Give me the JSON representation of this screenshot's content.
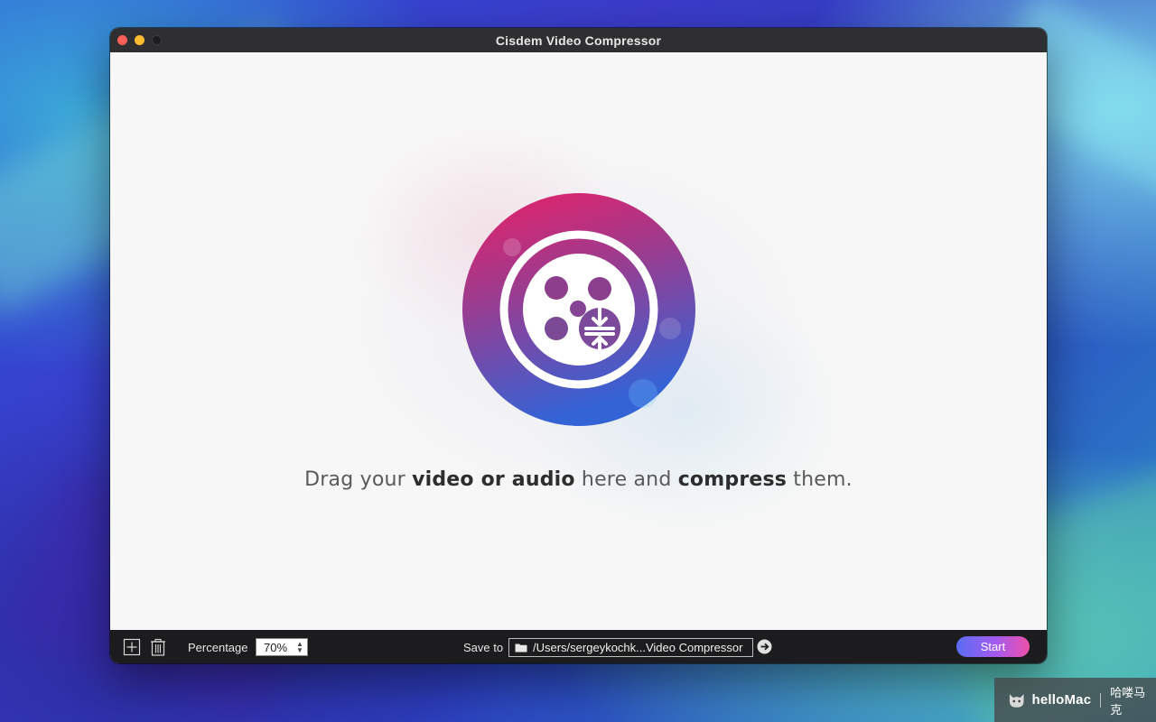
{
  "window": {
    "title": "Cisdem Video Compressor"
  },
  "content": {
    "drop_text_1": "Drag your ",
    "drop_text_bold_1": "video or audio",
    "drop_text_2": " here and ",
    "drop_text_bold_2": "compress",
    "drop_text_3": " them.",
    "logo_icon": "film-reel-compress-icon"
  },
  "toolbar": {
    "add_icon": "plus-square-icon",
    "trash_icon": "trash-icon",
    "percentage_label": "Percentage",
    "percentage_value": "70%",
    "save_to_label": "Save to",
    "save_path": "/Users/sergeykochk...Video Compressor",
    "go_icon": "arrow-right-circle-icon",
    "start_label": "Start"
  },
  "watermark": {
    "brand": "helloMac",
    "brand_cn": "哈喽马克"
  },
  "colors": {
    "accent_start": "#5a6cf2",
    "accent_end": "#ee4fa8",
    "logo_top": "#e0206e",
    "logo_bottom": "#3a5fd0"
  }
}
